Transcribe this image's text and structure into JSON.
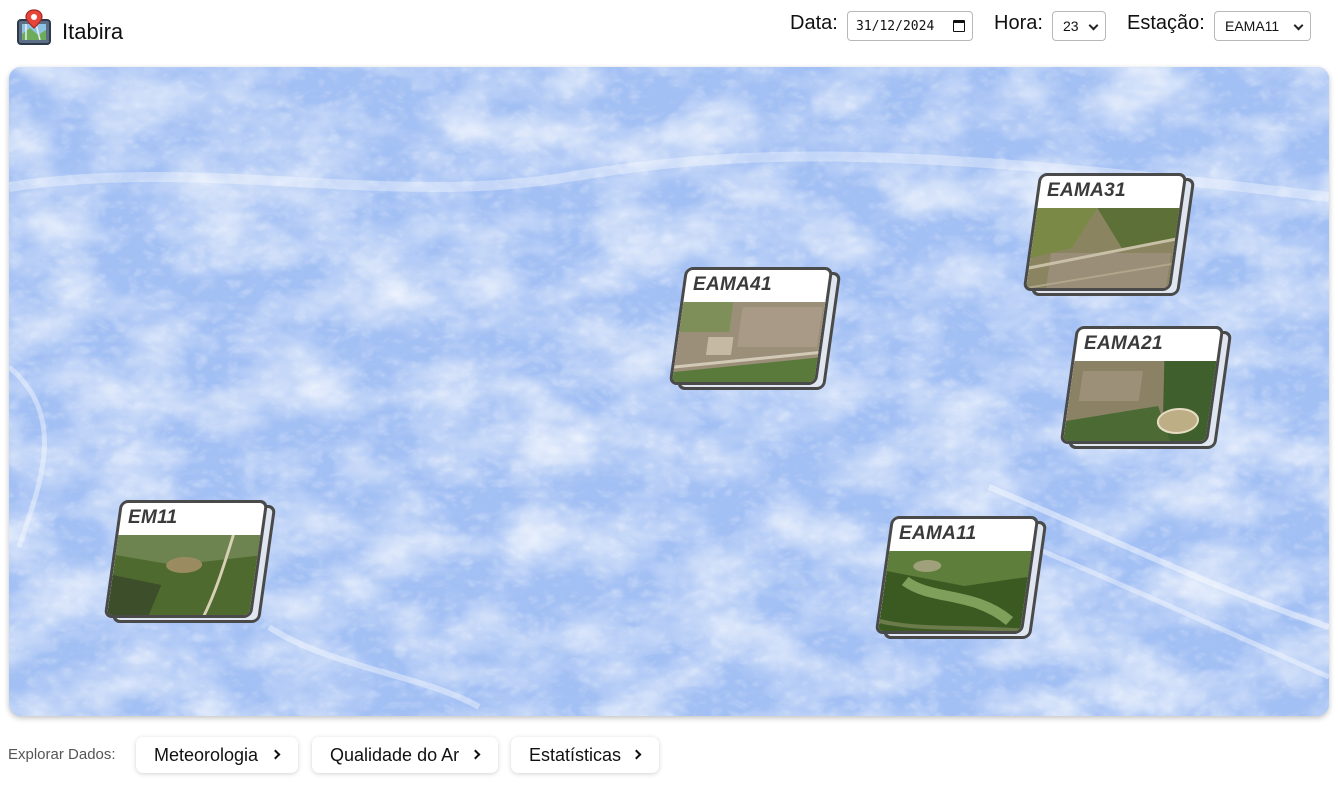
{
  "app": {
    "title": "Itabira",
    "logo_icon": "map-pin-icon"
  },
  "controls": {
    "date_label": "Data:",
    "date_value": "31/12/2024",
    "hour_label": "Hora:",
    "hour_value": "23",
    "station_label": "Estação:",
    "station_value": "EAMA11"
  },
  "map": {
    "stations": [
      {
        "id": "EAMA31",
        "label": "EAMA31"
      },
      {
        "id": "EAMA41",
        "label": "EAMA41"
      },
      {
        "id": "EAMA21",
        "label": "EAMA21"
      },
      {
        "id": "EM11",
        "label": "EM11"
      },
      {
        "id": "EAMA11",
        "label": "EAMA11"
      }
    ]
  },
  "footer": {
    "explore_label": "Explorar Dados:",
    "buttons": [
      {
        "label": "Meteorologia"
      },
      {
        "label": "Qualidade do Ar"
      },
      {
        "label": "Estatísticas"
      }
    ]
  },
  "colors": {
    "map_tint": "#9dbcf3",
    "card_border": "#4a4a4a"
  }
}
